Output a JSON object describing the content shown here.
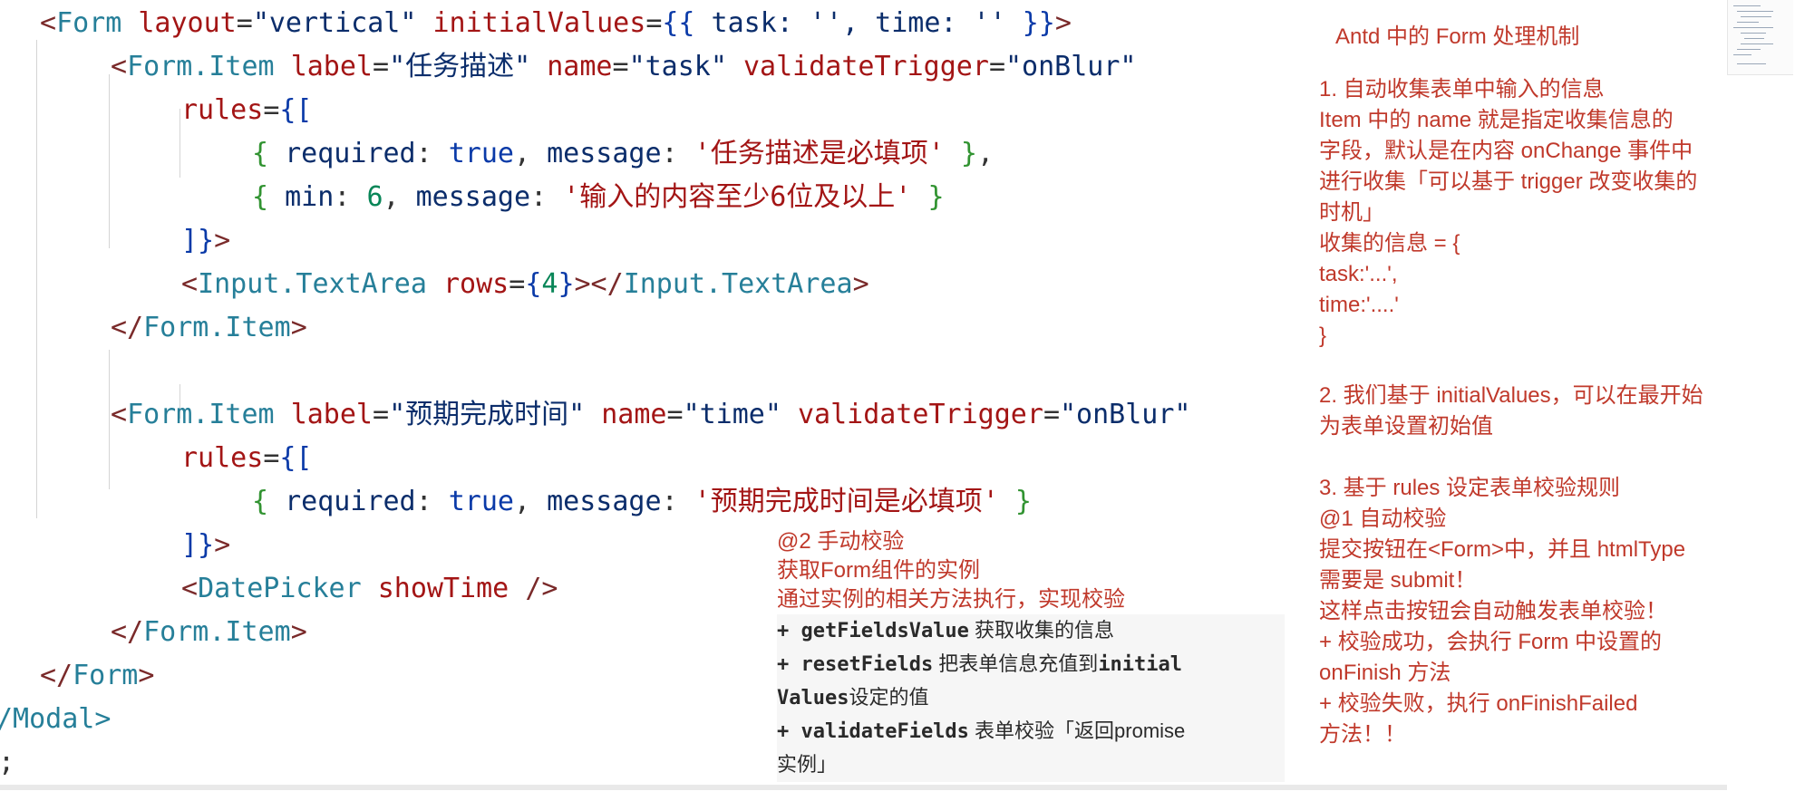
{
  "code": {
    "form_open": {
      "name": "Form",
      "attr_layout": "layout",
      "val_layout": "\"vertical\"",
      "attr_init": "initialValues",
      "obj": " task: '', time: '' "
    },
    "item1_open": {
      "name": "Form.Item",
      "attr_label": "label",
      "val_label": "\"任务描述\"",
      "attr_name": "name",
      "val_name": "\"task\"",
      "attr_trigger": "validateTrigger",
      "val_trigger": "\"onBlur\""
    },
    "rules1": {
      "attr": "rules",
      "rule_a": {
        "k1": "required",
        "v1": "true",
        "k2": "message",
        "v2": "'任务描述是必填项'"
      },
      "rule_b": {
        "k1": "min",
        "v1": "6",
        "k2": "message",
        "v2": "'输入的内容至少6位及以上'"
      }
    },
    "textarea": {
      "name": "Input.TextArea",
      "attr": "rows",
      "val": "4",
      "close": "Input.TextArea"
    },
    "item1_close": "Form.Item",
    "item2_open": {
      "name": "Form.Item",
      "attr_label": "label",
      "val_label": "\"预期完成时间\"",
      "attr_name": "name",
      "val_name": "\"time\"",
      "attr_trigger": "validateTrigger",
      "val_trigger": "\"onBlur\""
    },
    "rules2": {
      "attr": "rules",
      "rule_a": {
        "k1": "required",
        "v1": "true",
        "k2": "message",
        "v2": "'预期完成时间是必填项'"
      }
    },
    "datepicker": {
      "name": "DatePicker",
      "attr": "showTime"
    },
    "item2_close": "Form.Item",
    "form_close": "Form",
    "modal_close": "/Modal>",
    "tail": ";"
  },
  "middle_note": {
    "line1": "@2 手动校验",
    "line2": "获取Form组件的实例",
    "line3": "通过实例的相关方法执行，实现校验",
    "m1_code": "+ getFieldsValue",
    "m1_text": " 获取收集的信息",
    "m2_code": "+ resetFields",
    "m2_text": " 把表单信息充值到",
    "m2_code2": "initial",
    "m3_code": "Values",
    "m3_text": "设定的值",
    "m4_code": "+ validateFields",
    "m4_text": " 表单校验「返回promise",
    "m5_text": "实例」"
  },
  "right_notes": {
    "title": "Antd 中的 Form 处理机制",
    "lines": [
      "1. 自动收集表单中输入的信息",
      "   Item 中的 name 就是指定收集信息的",
      "字段，默认是在内容 onChange 事件中",
      "进行收集「可以基于 trigger 改变收集的",
      "时机」",
      "   收集的信息 = {",
      "       task:'...',",
      "       time:'....'",
      "   }",
      "2. 我们基于 initialValues，可以在最开始",
      "为表单设置初始值",
      "3. 基于 rules 设定表单校验规则",
      "  @1 自动校验",
      "  提交按钮在<Form>中，并且 htmlType",
      "需要是 submit！",
      "   这样点击按钮会自动触发表单校验！",
      "   + 校验成功，会执行 Form 中设置的",
      "onFinish 方法",
      "     + 校验失败，执行 onFinishFailed",
      "方法！！"
    ]
  }
}
